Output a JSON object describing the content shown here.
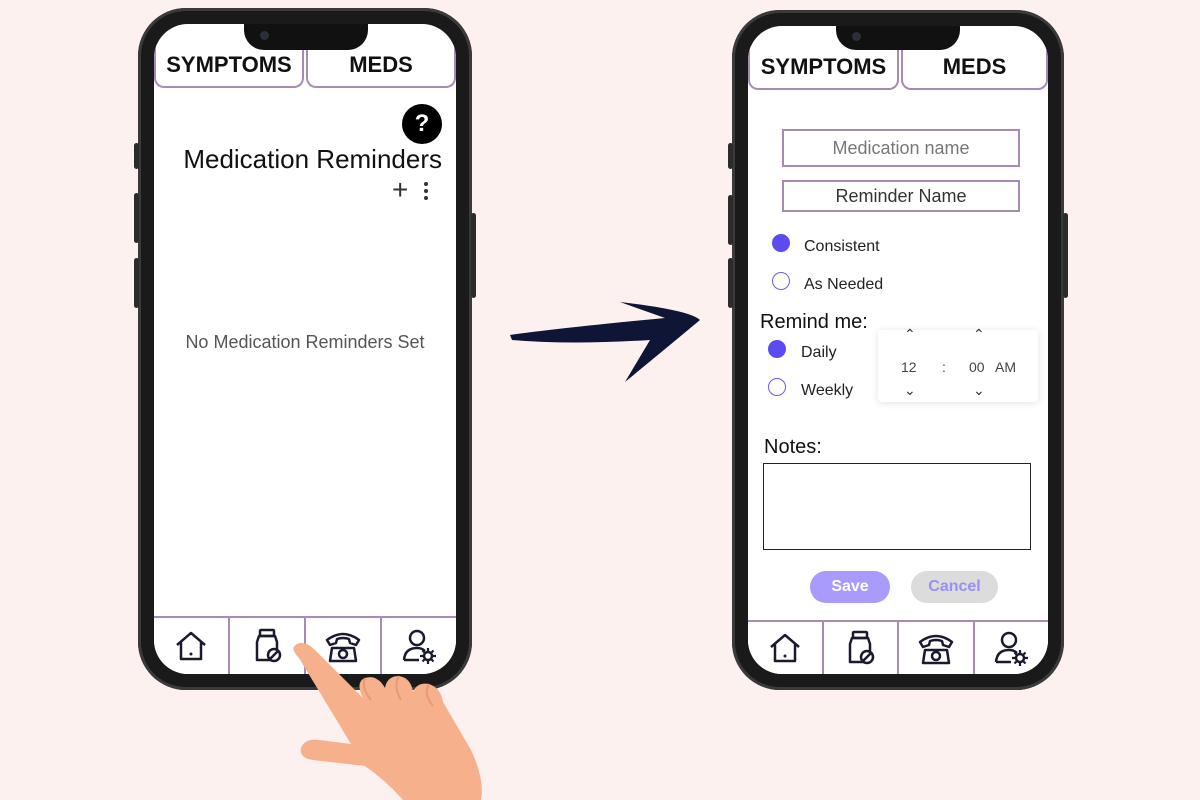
{
  "left_phone": {
    "tabs": [
      "SYMPTOMS",
      "MEDS"
    ],
    "help_label": "?",
    "title": "Medication Reminders",
    "add_label": "+",
    "empty_message": "No Medication Reminders Set"
  },
  "right_phone": {
    "tabs": [
      "SYMPTOMS",
      "MEDS"
    ],
    "medication_placeholder": "Medication name",
    "reminder_placeholder": "Reminder Name",
    "type_options": [
      "Consistent",
      "As Needed"
    ],
    "selected_type": "Consistent",
    "remind_label": "Remind me:",
    "frequency_options": [
      "Daily",
      "Weekly"
    ],
    "selected_frequency": "Daily",
    "time": {
      "hour": "12",
      "separator": ":",
      "minute": "00",
      "period": "AM"
    },
    "notes_label": "Notes:",
    "save_label": "Save",
    "cancel_label": "Cancel"
  },
  "nav_icons": [
    "home-icon",
    "medication-bottle-icon",
    "telephone-icon",
    "user-settings-icon"
  ],
  "colors": {
    "background": "#fdf1f0",
    "accent": "#a58bb6",
    "radio": "#5b4bf0",
    "save": "#a99bfb",
    "cancel": "#dcdcdc",
    "arrow": "#0e1535",
    "hand": "#f7b08c"
  }
}
